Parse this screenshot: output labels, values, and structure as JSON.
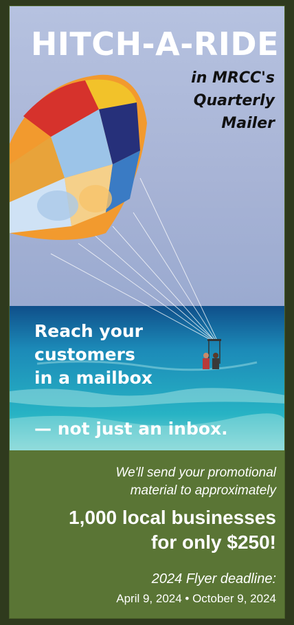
{
  "flyer": {
    "title": "HITCH-A-RIDE",
    "subtitle_lines": [
      "in MRCC's",
      "Quarterly",
      "Mailer"
    ],
    "reach_lines": [
      "Reach your",
      "customers",
      "in a mailbox"
    ],
    "tagline": "— not just an inbox.",
    "promo_lines": [
      "We'll send your promotional",
      "material to approximately"
    ],
    "highlight_lines": [
      "1,000 local businesses",
      "for only $250!"
    ],
    "deadline_label": "2024 Flyer deadline:",
    "deadline_dates": "April 9, 2024 • October 9, 2024",
    "image": {
      "subject": "parasail-over-ocean",
      "colors": {
        "sky": "#a9b7d8",
        "sea": "#1c8fb5",
        "panel": "#5a7535"
      }
    }
  }
}
